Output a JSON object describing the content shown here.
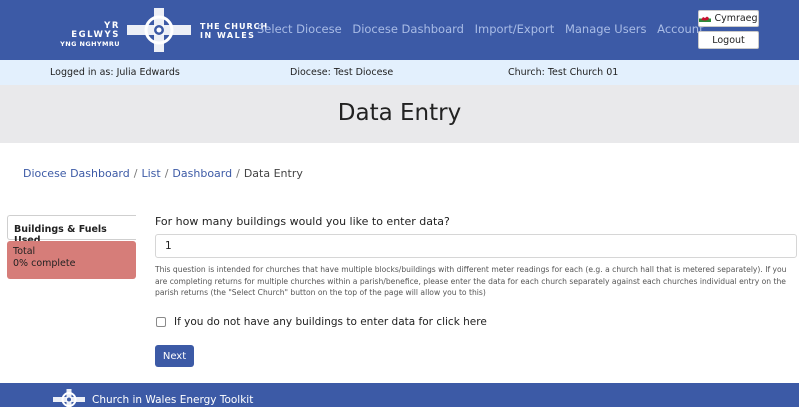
{
  "header": {
    "logo": {
      "welsh_line1": "YR EGLWYS",
      "welsh_line2": "YNG NGHYMRU",
      "english_line1": "THE CHURCH",
      "english_line2": "IN WALES"
    },
    "nav": [
      "Select Diocese",
      "Diocese Dashboard",
      "Import/Export",
      "Manage Users",
      "Account"
    ],
    "language_button": "Cymraeg",
    "language_icon": "welsh-flag-icon",
    "logout_button": "Logout",
    "colors": {
      "brand": "#3c5aa6"
    }
  },
  "info": {
    "user": "Logged in as: Julia Edwards",
    "diocese": "Diocese: Test Diocese",
    "church": "Church: Test Church 01"
  },
  "page_title": "Data Entry",
  "breadcrumb": [
    "Diocese Dashboard",
    "List",
    "Dashboard",
    "Data Entry"
  ],
  "sidebar": {
    "active_item": "Buildings & Fuels Used",
    "total_label": "Total",
    "total_progress": "0% complete",
    "progress_color": "#d67d79"
  },
  "form": {
    "question": "For how many buildings would you like to enter data?",
    "buildings_value": "1",
    "help_text": "This question is intended for churches that have multiple blocks/buildings with different meter readings for each (e.g. a church hall that is metered separately). If you are completing returns for multiple churches within a parish/benefice, please enter the data for each church separately against each churches individual entry on the parish returns (the \"Select Church\" button on the top of the page will allow you to this)",
    "no_buildings_checkbox": "If you do not have any buildings to enter data for click here",
    "no_buildings_checked": false,
    "next_button": "Next"
  },
  "footer": {
    "text": "Church in Wales Energy Toolkit",
    "icon": "celtic-cross-icon"
  }
}
